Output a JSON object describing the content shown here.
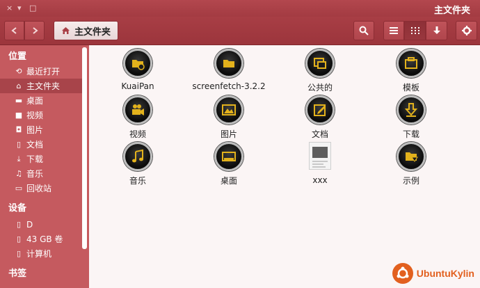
{
  "window": {
    "title": "主文件夹",
    "controls": [
      "×",
      "▾",
      "□"
    ]
  },
  "toolbar": {
    "back_icon": "arrow-left-icon",
    "forward_icon": "arrow-right-icon",
    "breadcrumb": "主文件夹",
    "search_icon": "search-icon",
    "view_list_icon": "list-icon",
    "view_grid_icon": "grid-icon",
    "sort_icon": "arrow-down-icon",
    "settings_icon": "gear-icon"
  },
  "sidebar": {
    "sections": [
      {
        "title": "位置",
        "items": [
          {
            "label": "最近打开",
            "icon": "clock-icon",
            "glyph": "⟲"
          },
          {
            "label": "主文件夹",
            "icon": "home-icon",
            "glyph": "⌂",
            "active": true
          },
          {
            "label": "桌面",
            "icon": "folder-icon",
            "glyph": "▬"
          },
          {
            "label": "视频",
            "icon": "film-icon",
            "glyph": "■"
          },
          {
            "label": "图片",
            "icon": "camera-icon",
            "glyph": "◘"
          },
          {
            "label": "文档",
            "icon": "document-icon",
            "glyph": "▯"
          },
          {
            "label": "下载",
            "icon": "download-icon",
            "glyph": "⤓"
          },
          {
            "label": "音乐",
            "icon": "music-icon",
            "glyph": "♫"
          },
          {
            "label": "回收站",
            "icon": "trash-icon",
            "glyph": "▭"
          }
        ]
      },
      {
        "title": "设备",
        "items": [
          {
            "label": "D",
            "icon": "drive-icon",
            "glyph": "▯"
          },
          {
            "label": "43 GB 卷",
            "icon": "drive-icon",
            "glyph": "▯"
          },
          {
            "label": "计算机",
            "icon": "drive-icon",
            "glyph": "▯"
          }
        ]
      },
      {
        "title": "书签",
        "items": []
      }
    ]
  },
  "files": [
    {
      "name": "KuaiPan",
      "icon": "sync-folder-icon"
    },
    {
      "name": "screenfetch-3.2.2",
      "icon": "folder-icon"
    },
    {
      "name": "公共的",
      "icon": "share-folder-icon"
    },
    {
      "name": "模板",
      "icon": "template-folder-icon"
    },
    {
      "name": "视频",
      "icon": "video-folder-icon"
    },
    {
      "name": "图片",
      "icon": "pictures-folder-icon"
    },
    {
      "name": "文档",
      "icon": "documents-folder-icon"
    },
    {
      "name": "下载",
      "icon": "download-folder-icon"
    },
    {
      "name": "音乐",
      "icon": "music-folder-icon"
    },
    {
      "name": "桌面",
      "icon": "desktop-folder-icon"
    },
    {
      "name": "xxx",
      "icon": "document-file-icon"
    },
    {
      "name": "示例",
      "icon": "examples-folder-icon"
    }
  ],
  "watermark": {
    "text": "UbuntuKylin"
  },
  "colors": {
    "titlebar": "#a83e45",
    "sidebar": "#c55a5f",
    "content_bg": "#fbf5f5",
    "icon_accent": "#e3b21c"
  }
}
